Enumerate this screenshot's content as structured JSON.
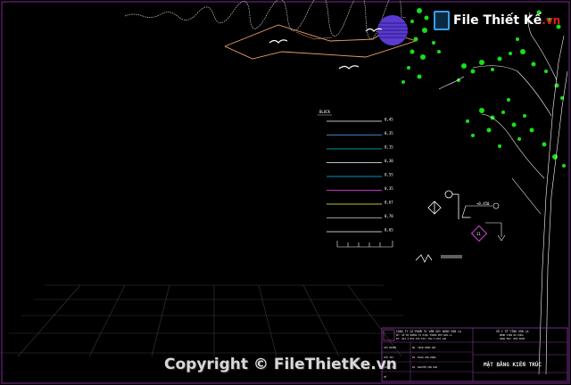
{
  "logo": {
    "name": "File Thiết Kế",
    "tld": ".vn"
  },
  "watermark": {
    "text": "Copyright © FileThietKe.vn"
  },
  "lineweight_legend": {
    "header": "BLOCK",
    "values": [
      "0,45",
      "0,35",
      "0,15",
      "0,30",
      "0,55",
      "0,35",
      "0,67",
      "0,78",
      "0,65"
    ],
    "colors": [
      "#ffffff",
      "#4fa8ff",
      "#00c8c8",
      "#ffffff",
      "#00c8ff",
      "#ff40ff",
      "#ffff40",
      "#c8c8c8",
      "#ffffff"
    ]
  },
  "symbols": {
    "elevation_label": "+0,450",
    "marker_number": "11"
  },
  "title_block": {
    "company_lines": [
      "CÔNG TY CỔ PHẦN TƯ VẤN XÂY DỰNG SƠN LA",
      "ĐC: SỐ 09 ĐƯỜNG TÔ HIỆU THÀNH PHỐ SƠN LA",
      "ĐT: 022.3.852.166  FAX: 022.3.852.166"
    ],
    "client_lines": [
      "SỞ Y TẾ TỈNH SƠN LA",
      "BỆNH VIỆN ĐA KHOA",
      "HẠNG MỤC: NHÀ KHÁM"
    ],
    "rows": [
      {
        "role": "CHỦ NHIỆM",
        "name": "NG. TRẦN MINH HẢI"
      },
      {
        "role": "CHỦ TRÌ",
        "name": "KS. ĐOÀN VĂN HÙNG"
      },
      {
        "role": "THIẾT KẾ",
        "name": "KS. NGUYỄN VĂN NAM"
      },
      {
        "role": "VẼ",
        "name": ""
      }
    ],
    "drawing_title": "MẶT BẰNG KIẾN TRÚC"
  },
  "colors": {
    "background": "#000000",
    "frame": "#8a3aa0",
    "mountain": "#e8a070",
    "moon": "#5a3ad0",
    "leaf": "#18e018",
    "trunk": "#ffffff",
    "ground": "#3a3a3a"
  }
}
